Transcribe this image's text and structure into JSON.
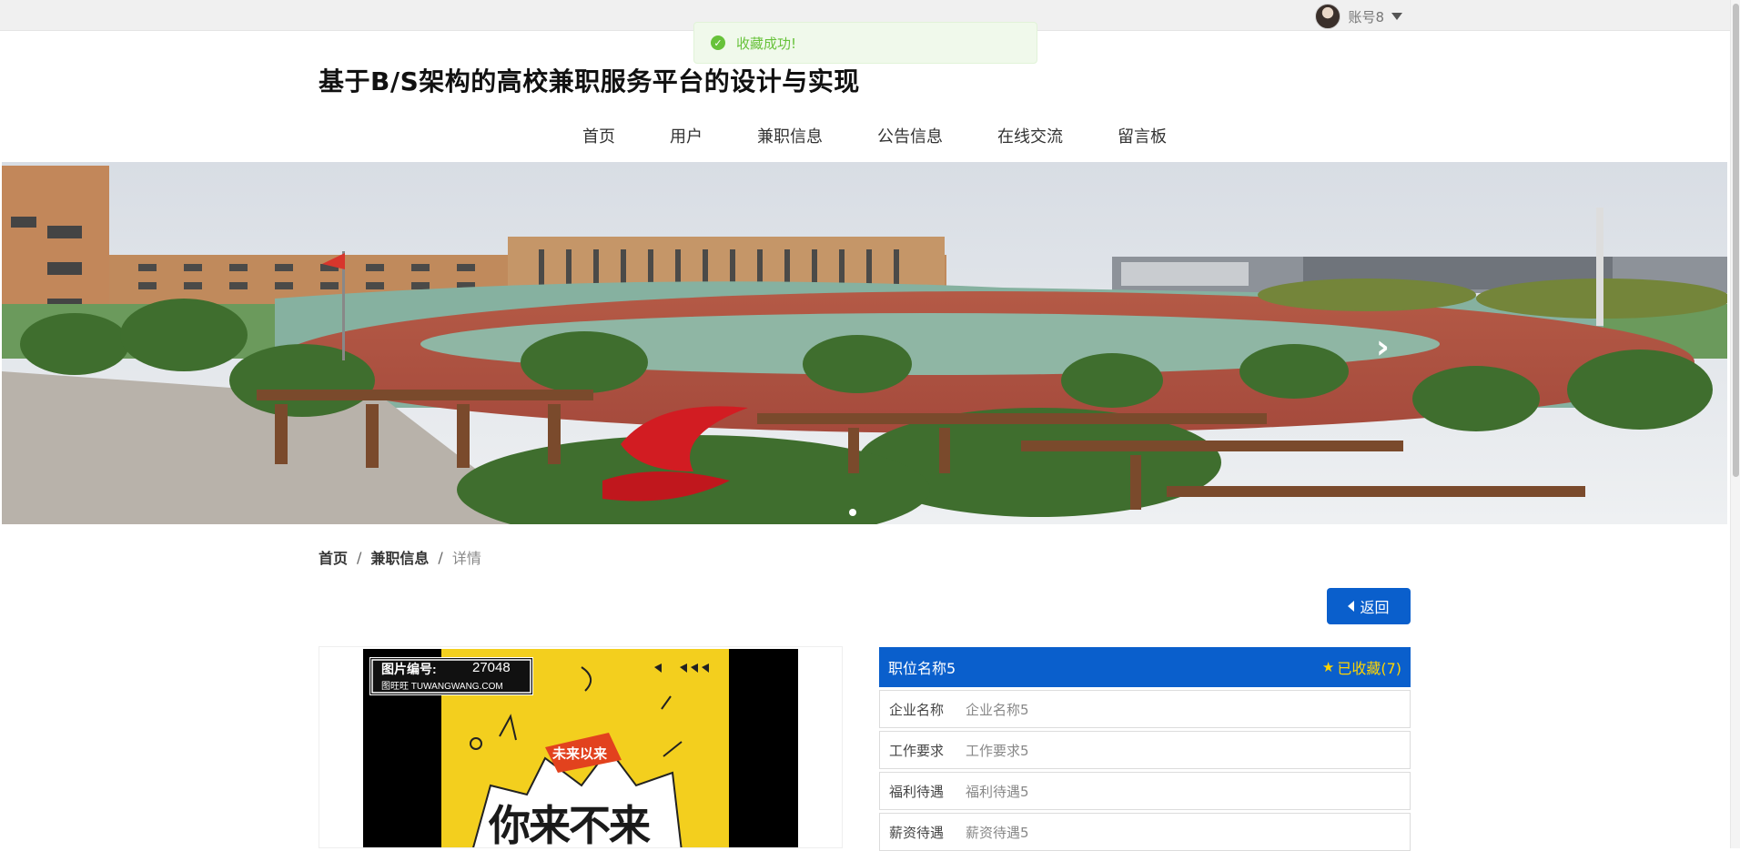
{
  "header": {
    "account_name": "账号8",
    "site_title": "基于B/S架构的高校兼职服务平台的设计与实现"
  },
  "toast": {
    "message": "收藏成功!"
  },
  "nav": {
    "items": [
      "首页",
      "用户",
      "兼职信息",
      "公告信息",
      "在线交流",
      "留言板"
    ]
  },
  "breadcrumb": [
    "首页",
    "兼职信息",
    "详情"
  ],
  "breadcrumb_separator": "/",
  "back_button": "返回",
  "poster": {
    "code_label": "图片编号:",
    "code": "27048",
    "site": "图旺旺 TUWANGWANG.COM",
    "ribbon": "未来以来",
    "headline": "你来不来"
  },
  "detail": {
    "title": "职位名称5",
    "favorite": "已收藏(7)",
    "rows": [
      {
        "label": "企业名称",
        "value": "企业名称5"
      },
      {
        "label": "工作要求",
        "value": "工作要求5"
      },
      {
        "label": "福利待遇",
        "value": "福利待遇5"
      },
      {
        "label": "薪资待遇",
        "value": "薪资待遇5"
      }
    ]
  },
  "colors": {
    "primary": "#0a5fcc",
    "success": "#67c23a",
    "favorite": "#ffd400"
  },
  "icons": [
    "avatar-icon",
    "caret-down-icon",
    "check-circle-icon",
    "chevron-right-icon",
    "caret-left-icon",
    "star-icon"
  ]
}
